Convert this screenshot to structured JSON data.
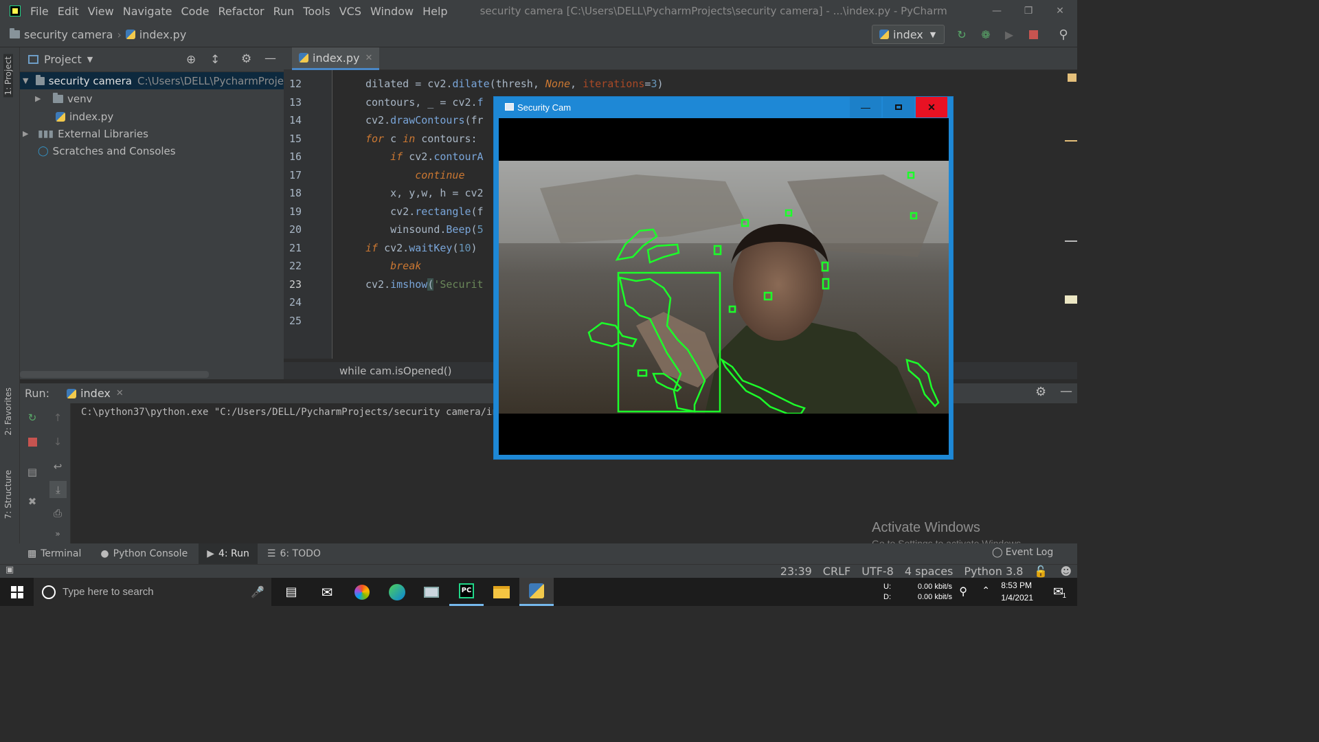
{
  "menu": [
    "File",
    "Edit",
    "View",
    "Navigate",
    "Code",
    "Refactor",
    "Run",
    "Tools",
    "VCS",
    "Window",
    "Help"
  ],
  "window_title": "security camera [C:\\Users\\DELL\\PycharmProjects\\security camera] - ...\\index.py - PyCharm",
  "nav": {
    "project": "security camera",
    "file": "index.py",
    "run_config": "index"
  },
  "left_tabs": [
    "1: Project",
    "2: Favorites",
    "7: Structure"
  ],
  "project_panel": {
    "title": "Project",
    "tree": [
      {
        "label": "security camera",
        "path": "C:\\Users\\DELL\\PycharmProje"
      },
      {
        "label": "venv"
      },
      {
        "label": "index.py"
      },
      {
        "label": "External Libraries"
      },
      {
        "label": "Scratches and Consoles"
      }
    ]
  },
  "editor": {
    "tab": "index.py",
    "line_numbers": [
      "12",
      "13",
      "14",
      "15",
      "16",
      "17",
      "18",
      "19",
      "20",
      "21",
      "22",
      "23",
      "24",
      "25"
    ],
    "breadcrumb": "while cam.isOpened()"
  },
  "run": {
    "label": "Run:",
    "tab": "index",
    "command": "C:\\python37\\python.exe \"C:/Users/DELL/PycharmProjects/security camera/inde"
  },
  "bottom_tabs": [
    "Terminal",
    "Python Console",
    "4: Run",
    "6: TODO"
  ],
  "status": {
    "position": "23:39",
    "line_sep": "CRLF",
    "encoding": "UTF-8",
    "indent": "4 spaces",
    "interpreter": "Python 3.8",
    "event_log": "Event Log"
  },
  "activate": {
    "title": "Activate Windows",
    "subtitle": "Go to Settings to activate Windows."
  },
  "cam_window": {
    "title": "Security Cam"
  },
  "taskbar": {
    "search_placeholder": "Type here to search",
    "net_up_label": "U:",
    "net_down_label": "D:",
    "net_up": "0.00 kbit/s",
    "net_down": "0.00 kbit/s",
    "time": "8:53 PM",
    "date": "1/4/2021",
    "notif_count": "1"
  }
}
